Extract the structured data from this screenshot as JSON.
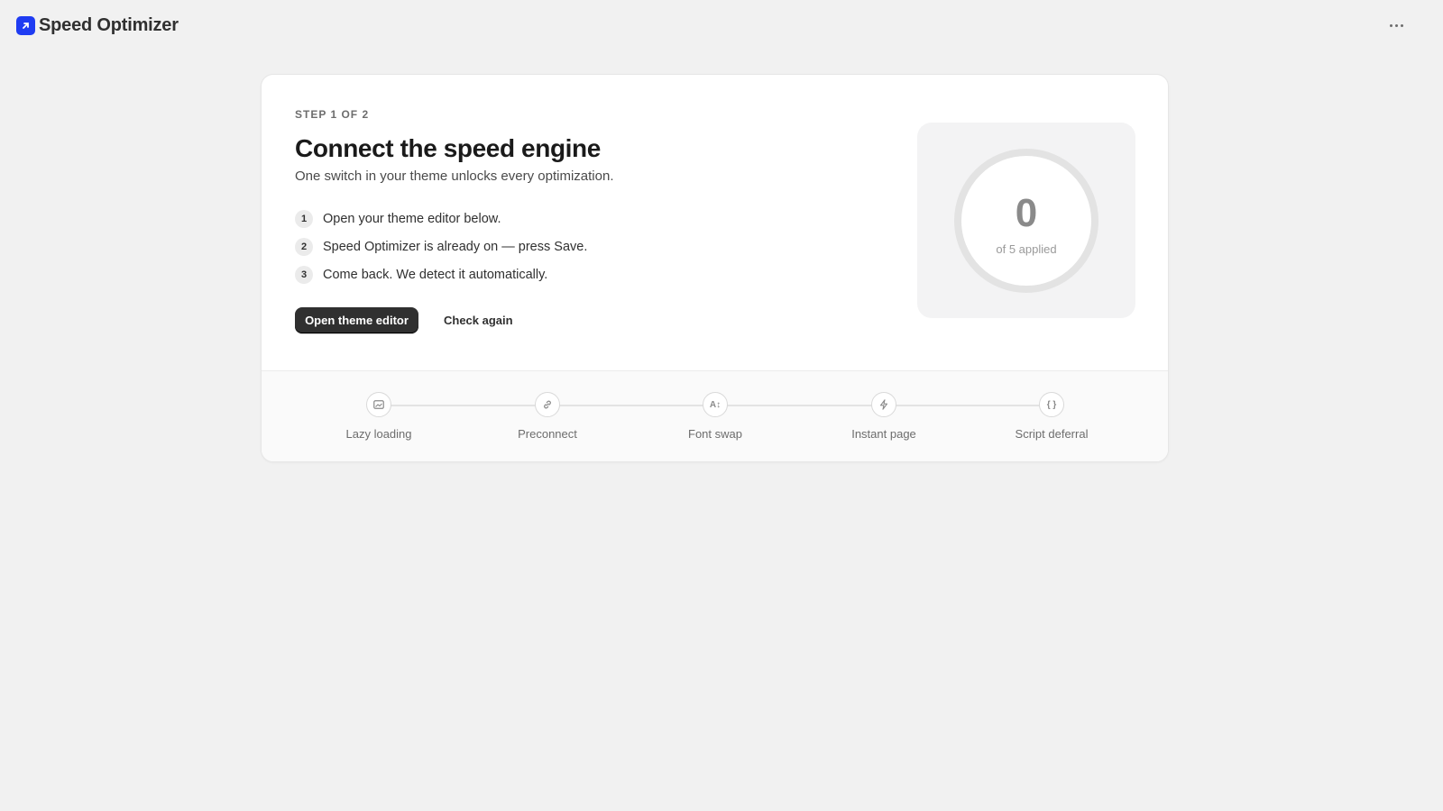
{
  "app": {
    "title": "Speed Optimizer"
  },
  "onboarding": {
    "step_label": "STEP 1 OF 2",
    "headline": "Connect the speed engine",
    "subhead": "One switch in your theme unlocks every optimization.",
    "steps": [
      {
        "number": "1",
        "text": "Open your theme editor below."
      },
      {
        "number": "2",
        "text": "Speed Optimizer is already on — press Save."
      },
      {
        "number": "3",
        "text": "Come back. We detect it automatically."
      }
    ],
    "primary_action": "Open theme editor",
    "secondary_action": "Check again"
  },
  "progress": {
    "count": "0",
    "caption": "of 5 applied",
    "applied": 0,
    "total": 5
  },
  "features": [
    {
      "label": "Lazy loading",
      "icon": "image-icon"
    },
    {
      "label": "Preconnect",
      "icon": "link-icon"
    },
    {
      "label": "Font swap",
      "icon": "font-icon",
      "glyph": "A↕"
    },
    {
      "label": "Instant page",
      "icon": "bolt-icon"
    },
    {
      "label": "Script deferral",
      "icon": "code-braces-icon",
      "glyph": "{ }"
    }
  ],
  "colors": {
    "brand": "#1f3cf2",
    "primary_button": "#303030",
    "background": "#f1f1f1"
  }
}
